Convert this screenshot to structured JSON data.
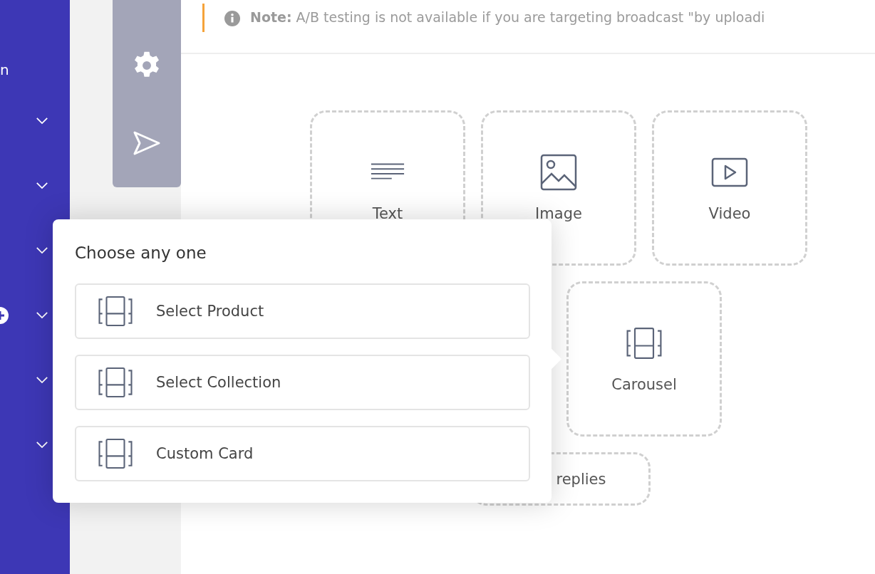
{
  "sidebar": {
    "label": "n",
    "items": [
      {
        "expanded": false
      },
      {
        "expanded": false
      },
      {
        "expanded": false
      },
      {
        "expanded": false
      },
      {
        "expanded": false
      },
      {
        "expanded": false
      }
    ]
  },
  "note": {
    "label": "Note:",
    "text": "A/B testing is not available if you are targeting broadcast \"by uploadi"
  },
  "message_types": [
    {
      "kind": "text",
      "label": "Text"
    },
    {
      "kind": "image",
      "label": "Image"
    },
    {
      "kind": "video",
      "label": "Video"
    },
    {
      "kind": "carousel",
      "label": "Carousel"
    },
    {
      "kind": "replies",
      "label": "replies"
    }
  ],
  "popup": {
    "title": "Choose any one",
    "options": [
      {
        "label": "Select Product"
      },
      {
        "label": "Select Collection"
      },
      {
        "label": "Custom Card"
      }
    ]
  }
}
